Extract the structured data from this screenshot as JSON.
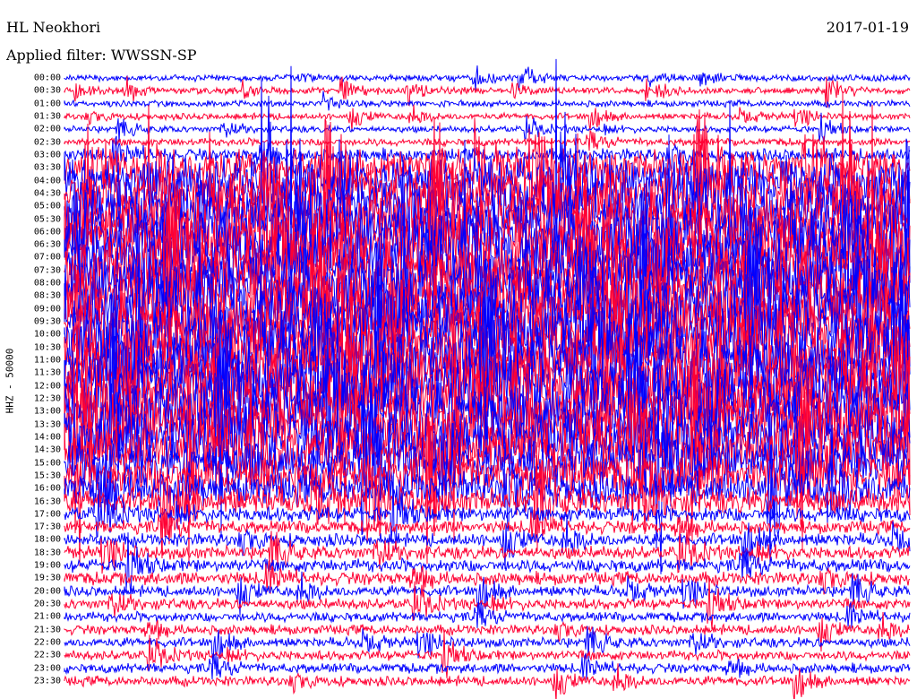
{
  "chart_data": {
    "type": "line",
    "title": "HL Neokhori",
    "date": "2017-01-19",
    "filter_label": "Applied filter: WWSSN-SP",
    "ylabel": "HHZ - 50000",
    "row_labels": [
      "00:00",
      "00:30",
      "01:00",
      "01:30",
      "02:00",
      "02:30",
      "03:00",
      "03:30",
      "04:00",
      "04:30",
      "05:00",
      "05:30",
      "06:00",
      "06:30",
      "07:00",
      "07:30",
      "08:00",
      "08:30",
      "09:00",
      "09:30",
      "10:00",
      "10:30",
      "11:00",
      "11:30",
      "12:00",
      "12:30",
      "13:00",
      "13:30",
      "14:00",
      "14:30",
      "15:00",
      "15:30",
      "16:00",
      "16:30",
      "17:00",
      "17:30",
      "18:00",
      "18:30",
      "19:00",
      "19:30",
      "20:00",
      "20:30",
      "21:00",
      "21:30",
      "22:00",
      "22:30",
      "23:00",
      "23:30"
    ],
    "relative_amplitude": [
      0.3,
      0.3,
      0.3,
      0.3,
      0.3,
      0.35,
      0.6,
      1.6,
      2.2,
      2.4,
      2.6,
      2.8,
      3,
      3,
      3,
      3,
      3,
      3,
      3,
      3,
      3,
      3,
      3,
      3,
      3,
      3,
      3,
      2.8,
      2.6,
      2.4,
      2.2,
      1.9,
      1.6,
      1.2,
      0.7,
      0.6,
      0.6,
      0.6,
      0.6,
      0.6,
      0.5,
      0.5,
      0.45,
      0.45,
      0.45,
      0.45,
      0.45,
      0.45
    ],
    "series_colors": [
      "#0000ff",
      "#ff0033"
    ]
  }
}
